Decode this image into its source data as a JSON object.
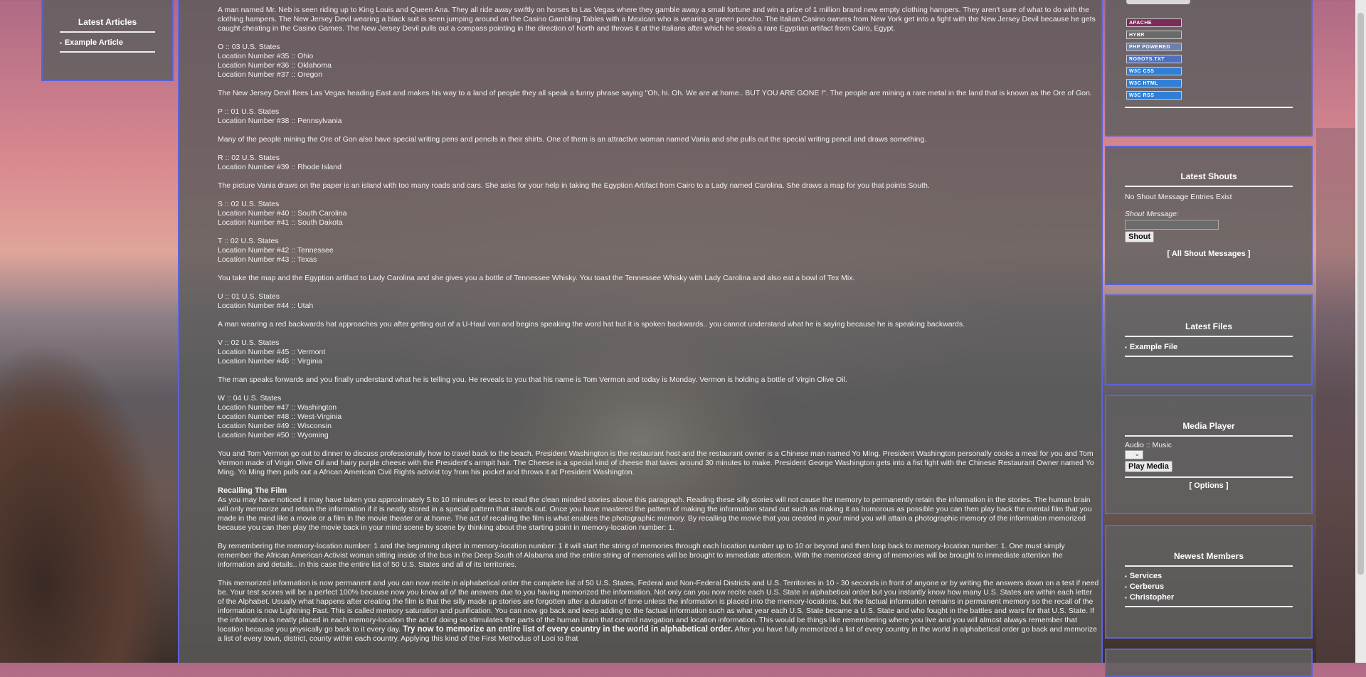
{
  "left": {
    "title": "Latest Articles",
    "items": [
      "Example Article"
    ]
  },
  "main": {
    "paragraphs": [
      "A man named Mr. Neb is seen riding up to King Louis and Queen Ana. They all ride away swiftly on horses to Las Vegas where they gamble away a small fortune and win a prize of 1 million brand new empty clothing hampers. They aren't sure of what to do with the clothing hampers. The New Jersey Devil wearing a black suit is seen jumping around on the Casino Gambling Tables with a Mexican who is wearing a green poncho. The Italian Casino owners from New York get into a fight with the New Jersey Devil because he gets caught cheating in the Casino Games. The New Jersey Devil pulls out a compass pointing in the direction of North and throws it at the Italians after which he steals a rare Egyptian artifact from Cairo, Egypt.",
      "O :: 03 U.S. States\nLocation Number #35 :: Ohio\nLocation Number #36 :: Oklahoma\nLocation Number #37 :: Oregon",
      "The New Jersey Devil flees Las Vegas heading East and makes his way to a land of people they all speak a funny phrase saying \"Oh, hi. Oh. We are at home.. BUT YOU ARE GONE !\". The people are mining a rare metal in the land that is known as the Ore of Gon.",
      "P :: 01 U.S. States\nLocation Number #38 :: Pennsylvania",
      "Many of the people mining the Ore of Gon also have special writing pens and pencils in their shirts. One of them is an attractive woman named Vania and she pulls out the special writing pencil and draws something.",
      "R :: 02 U.S. States\nLocation Number #39 :: Rhode Island",
      "The picture Vania draws on the paper is an island with too many roads and cars. She asks for your help in taking the Egyption Artifact from Cairo to a Lady named Carolina. She draws a map for you that points South.",
      "S :: 02 U.S. States\nLocation Number #40 :: South Carolina\nLocation Number #41 :: South Dakota",
      "T :: 02 U.S. States\nLocation Number #42 :: Tennessee\nLocation Number #43 :: Texas",
      "You take the map and the Egyption artifact to Lady Carolina and she gives you a bottle of Tennessee Whisky. You toast the Tennessee Whisky with Lady Carolina and also eat a bowl of Tex Mix.",
      "U :: 01 U.S. States\nLocation Number #44 :: Utah",
      "A man wearing a red backwards hat approaches you after getting out of a U-Haul van and begins speaking the word hat but it is spoken backwards.. you cannot understand what he is saying because he is speaking backwards.",
      "V :: 02 U.S. States\nLocation Number #45 :: Vermont\nLocation Number #46 :: Virginia",
      "The man speaks forwards and you finally understand what he is telling you. He reveals to you that his name is Tom Vermon and today is Monday. Vermon is holding a bottle of Virgin Olive Oil.",
      "W :: 04 U.S. States\nLocation Number #47 :: Washington\nLocation Number #48 :: West-Virginia\nLocation Number #49 :: Wisconsin\nLocation Number #50 :: Wyoming",
      "You and Tom Vermon go out to dinner to discuss professionally how to travel back to the beach. President Washington is the restaurant host and the restaurant owner is a Chinese man named Yo Ming. President Washington personally cooks a meal for you and Tom Vermon made of Virgin Olive Oil and hairy purple cheese with the President's armpit hair. The Cheese is a special kind of cheese that takes around 30 minutes to make. President George Washington gets into a fist fight with the Chinese Restaurant Owner named Yo Ming. Yo Ming then pulls out a African American Civil Rights activist toy from his pocket and throws it at President Washington."
    ],
    "recall_heading": "Recalling The Film",
    "recall_text": "As you may have noticed it may have taken you approximately 5 to 10 minutes or less to read the clean minded stories above this paragraph. Reading these silly stories will not cause the memory to permanently retain the information in the stories. The human brain will only memorize and retain the information if it is neatly stored in a special pattern that stands out. Once you have mastered the pattern of making the information stand out such as making it as humorous as possible you can then play back the mental film that you made in the mind like a movie or a film in the movie theater or at home. The act of recalling the film is what enables the photographic memory. By recalling the movie that you created in your mind you will attain a photographic memory of the information memorized because you can then play the movie back in your mind scene by scene by thinking about the starting point in memory-location number: 1.",
    "remember_text": "By remembering the memory-location number: 1 and the beginning object in memory-location number: 1 it will start the string of memories through each location number up to 10 or beyond and then loop back to memory-location number: 1. One must simply remember the African American Activist woman sitting inside of the bus in the Deep South of Alabama and the entire string of memories will be brought to immediate attention. With the memorized string of memories will be brought to immediate attention the information and details.. in this case the entire list of 50 U.S. States and all of its territories.",
    "permanent_text_a": "This memorized information is now permanent and you can now recite in alphabetical order the complete list of 50 U.S. States, Federal and Non-Federal Districts and U.S. Territories in 10 - 30 seconds in front of anyone or by writing the answers down on a test if need be. Your test scores will be a perfect 100% because now you know all of the answers due to you having memorized the information. Not only can you now recite each U.S. State in alphabetical order but you instantly know how many U.S. States are within each letter of the Alphabet. Usually what happens after creating the film is that the silly made up stories are forgotten after a duration of time unless the information is placed into the memory-locations, but the factual information remains in permanent memory so the recall of the information is now Lightning Fast. This is called memory saturation and purification. You can now go back and keep adding to the factual information such as what year each U.S. State became a U.S. State and who fought in the battles and wars for that U.S. State. If the information is neatly placed in each memory-location the act of doing so stimulates the parts of the human brain that control navigation and location information. This would be things like remembering where you live and you will almost always remember that location because you physically go back to it every day.",
    "permanent_bold": "Try now to memorize an entire list of every country in the world in alphabetical order.",
    "permanent_text_b": "After you have fully memorized a list of every country in the world in alphabetical order go back and memorize a list of every town, district, county within each country. Applying this kind of the First Methodus of Loci to that"
  },
  "right": {
    "badges": [
      {
        "label": "APACHE",
        "color": "#7c2a59"
      },
      {
        "label": "HYBR",
        "color": "#6a6a6a"
      },
      {
        "label": "PHP POWERED",
        "color": "#6f7fa8"
      },
      {
        "label": "ROBOTS.TXT",
        "color": "#4f6fbf"
      },
      {
        "label": "W3C CSS",
        "color": "#2f7fd6"
      },
      {
        "label": "W3C HTML",
        "color": "#2f7fd6"
      },
      {
        "label": "W3C RSS",
        "color": "#2f7fd6"
      }
    ],
    "shouts": {
      "title": "Latest Shouts",
      "empty": "No Shout Message Entries Exist",
      "label": "Shout Message:",
      "button": "Shout",
      "all_link": "[ All Shout Messages ]"
    },
    "files": {
      "title": "Latest Files",
      "items": [
        "Example File"
      ]
    },
    "media": {
      "title": "Media Player",
      "category": "Audio :: Music",
      "button": "Play Media",
      "options_link": "[ Options ]"
    },
    "members": {
      "title": "Newest Members",
      "items": [
        "Services",
        "Cerberus",
        "Christopher"
      ]
    }
  }
}
